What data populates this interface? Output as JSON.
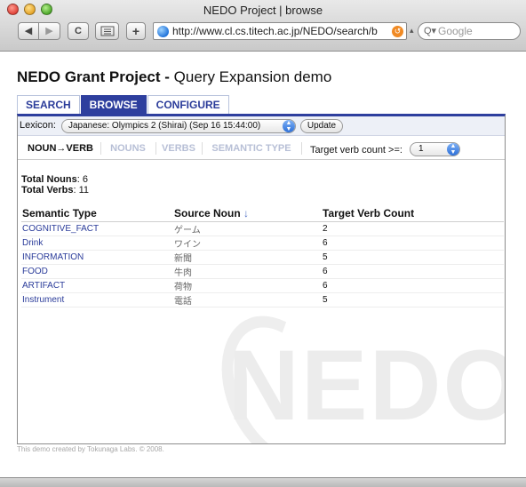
{
  "window": {
    "title": "NEDO Project | browse",
    "url": "http://www.cl.cs.titech.ac.jp/NEDO/search/b",
    "search_placeholder": "Google",
    "search_prefix": "Q▾",
    "back": "◀",
    "forward": "▶",
    "reload": "C",
    "add": "+",
    "snapback": "↺",
    "url_dropdown": "▴"
  },
  "page": {
    "title_bold": "NEDO Grant Project -",
    "title_rest": " Query Expansion demo",
    "tabs": [
      {
        "label": "SEARCH",
        "active": false
      },
      {
        "label": "BROWSE",
        "active": true
      },
      {
        "label": "CONFIGURE",
        "active": false
      }
    ],
    "lexicon": {
      "label": "Lexicon:",
      "selected": "Japanese: Olympics 2 (Shirai) (Sep 16 15:44:00)",
      "update_button": "Update"
    },
    "subtabs": [
      {
        "label": "NOUN→VERB",
        "active": true
      },
      {
        "label": "NOUNS",
        "active": false
      },
      {
        "label": "VERBS",
        "active": false
      },
      {
        "label": "SEMANTIC TYPE",
        "active": false
      }
    ],
    "target_verb": {
      "label": "Target verb count >=:",
      "selected": "1"
    },
    "totals": {
      "nouns_label": "Total Nouns",
      "nouns_value": ": 6",
      "verbs_label": "Total Verbs",
      "verbs_value": ": 11"
    },
    "table": {
      "headers": [
        "Semantic Type",
        "Source Noun",
        "Target Verb Count"
      ],
      "sort_indicator": "↓",
      "rows": [
        {
          "type": "COGNITIVE_FACT",
          "noun": "ゲーム",
          "count": "2"
        },
        {
          "type": "Drink",
          "noun": "ワイン",
          "count": "6"
        },
        {
          "type": "INFORMATION",
          "noun": "新聞",
          "count": "5"
        },
        {
          "type": "FOOD",
          "noun": "牛肉",
          "count": "6"
        },
        {
          "type": "ARTIFACT",
          "noun": "荷物",
          "count": "6"
        },
        {
          "type": "Instrument",
          "noun": "電話",
          "count": "5"
        }
      ]
    },
    "watermark": "NEDO",
    "footer": "This demo created by Tokunaga Labs. © 2008."
  },
  "colors": {
    "accent": "#2e3f9e",
    "link": "#2b3c9a",
    "inactive_subtab": "#b7bfd6"
  }
}
